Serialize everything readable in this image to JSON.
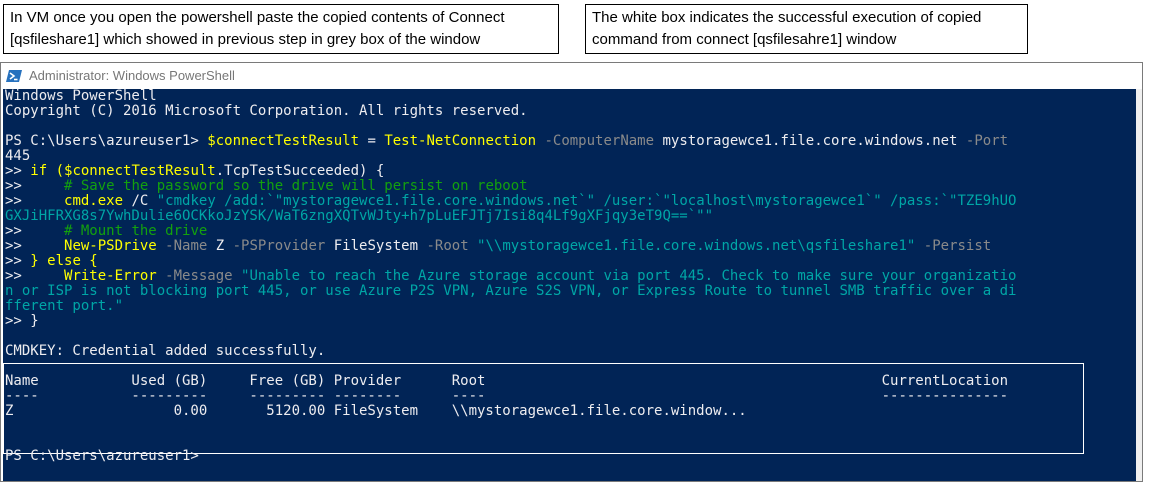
{
  "callouts": {
    "left": "In VM once you open the powershell paste the copied contents of Connect\n[qsfileshare1] which showed in previous step in grey box of the window",
    "right": "The white box indicates the successful execution of copied\ncommand from connect [qsfilesahre1] window"
  },
  "window": {
    "title": "Administrator: Windows PowerShell"
  },
  "console": {
    "banner1": "Windows PowerShell",
    "banner2": "Copyright (C) 2016 Microsoft Corporation. All rights reserved.",
    "prompt": "PS C:\\Users\\azureuser1> ",
    "cmd_var": "$connectTestResult",
    "cmd_eq": " = ",
    "cmd_name": "Test-NetConnection",
    "cmd_param1": " -ComputerName",
    "cmd_host": " mystoragewce1.file.core.windows.net",
    "cmd_param2": " -Port",
    "cmd_port": "445",
    "l_if_a": ">> ",
    "l_if_b": "if (",
    "l_if_c": "$connectTestResult",
    "l_if_d": ".TcpTestSucceeded) {",
    "l_c1_a": ">>     ",
    "l_c1_b": "# Save the password so the drive will persist on reboot",
    "l_cmd_a": ">>     ",
    "l_cmd_b": "cmd.exe",
    "l_cmd_c": " /C ",
    "l_cmd_d": "\"cmdkey /add:`\"mystoragewce1.file.core.windows.net`\" /user:`\"localhost\\mystoragewce1`\" /pass:`\"TZE9hUO",
    "l_cmd_e": "GXJiHFRXG8s7YwhDulie6OCKkoJzYSK/WaT6zngXQTvWJty+h7pLuEFJTj7Isi8q4Lf9gXFjqy3eT9Q==`\"\"",
    "l_c2_a": ">>     ",
    "l_c2_b": "# Mount the drive",
    "l_np_a": ">>     ",
    "l_np_b": "New-PSDrive",
    "l_np_c": " -Name",
    "l_np_d": " Z",
    "l_np_e": " -PSProvider",
    "l_np_f": " FileSystem",
    "l_np_g": " -Root",
    "l_np_h": " \"\\\\mystoragewce1.file.core.windows.net\\qsfileshare1\"",
    "l_np_i": " -Persist",
    "l_else_a": ">> ",
    "l_else_b": "} else {",
    "l_we_a": ">>     ",
    "l_we_b": "Write-Error",
    "l_we_c": " -Message",
    "l_we_d": " \"Unable to reach the Azure storage account via port 445. Check to make sure your organizatio",
    "l_we_e": "n or ISP is not blocking port 445, or use Azure P2S VPN, Azure S2S VPN, or Express Route to tunnel SMB traffic over a di",
    "l_we_f": "fferent port.\"",
    "l_end": ">> }",
    "cmdkey": "CMDKEY: Credential added successfully.",
    "table_header": "Name           Used (GB)     Free (GB) Provider      Root                                               CurrentLocation",
    "table_rule": "----           ---------     --------- --------      ----                                               ---------------",
    "table_row": "Z                   0.00       5120.00 FileSystem    \\\\mystoragewce1.file.core.window...",
    "final_prompt": "PS C:\\Users\\azureuser1>"
  }
}
